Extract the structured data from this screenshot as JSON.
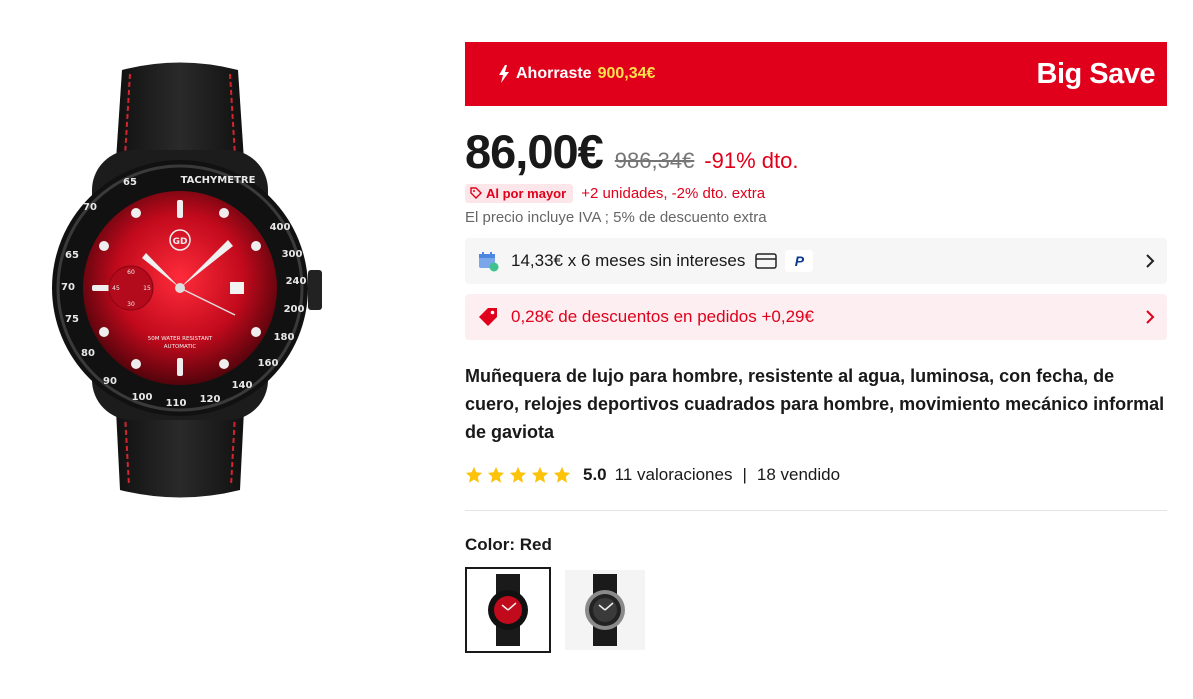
{
  "banner": {
    "saved_label": "Ahorraste",
    "saved_amount": "900,34€",
    "promo_label": "Big Save"
  },
  "price": {
    "current": "86,00€",
    "original": "986,34€",
    "discount": "-91% dto."
  },
  "wholesale": {
    "tag": "Al por mayor",
    "text": "+2 unidades, -2% dto. extra"
  },
  "vat_note": "El precio incluye IVA ; 5% de descuento extra",
  "installments": {
    "text": "14,33€ x 6 meses sin intereses",
    "paypal_letter": "P"
  },
  "coupon": {
    "text": "0,28€ de descuentos en pedidos +0,29€"
  },
  "product": {
    "title": "Muñequera de lujo para hombre, resistente al agua, luminosa, con fecha, de cuero, relojes deportivos cuadrados para hombre, movimiento mecánico informal de gaviota",
    "rating": "5.0",
    "reviews": "11 valoraciones",
    "sold": "18 vendido",
    "stars": 5,
    "separator": "|"
  },
  "color": {
    "label": "Color:",
    "value": "Red"
  },
  "watch": {
    "brand": "GD",
    "bezel_label": "TACHYMETRE",
    "dial_text_1": "50M WATER RESISTANT",
    "dial_text_2": "AUTOMATIC",
    "bezel_numbers": [
      "400",
      "300",
      "240",
      "200",
      "180",
      "160",
      "140",
      "120",
      "110",
      "100",
      "90",
      "80",
      "75",
      "70",
      "65"
    ],
    "subdial": [
      "60",
      "45",
      "15",
      "30"
    ]
  },
  "colors": {
    "accent": "#e0001b",
    "highlight": "#ffe14d",
    "star": "#fcc30a"
  }
}
